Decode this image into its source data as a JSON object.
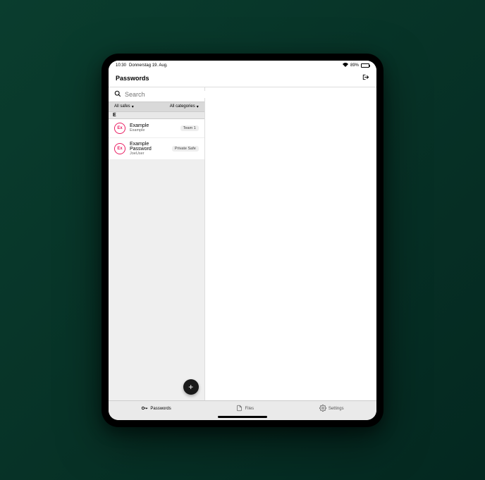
{
  "status": {
    "time": "10:30",
    "date": "Donnerstag 19. Aug.",
    "battery": "89%"
  },
  "nav": {
    "title": "Passwords"
  },
  "search": {
    "placeholder": "Search"
  },
  "filters": {
    "safes": "All safes",
    "categories": "All categories"
  },
  "section": {
    "header": "E"
  },
  "items": [
    {
      "avatar": "Ex",
      "title": "Example",
      "subtitle": "Example",
      "tag": "Team 1"
    },
    {
      "avatar": "Ex",
      "title": "Example Password",
      "subtitle": "JoeUser",
      "tag": "Private Safe"
    }
  ],
  "tabs": {
    "passwords": "Passwords",
    "files": "Files",
    "settings": "Settings"
  }
}
